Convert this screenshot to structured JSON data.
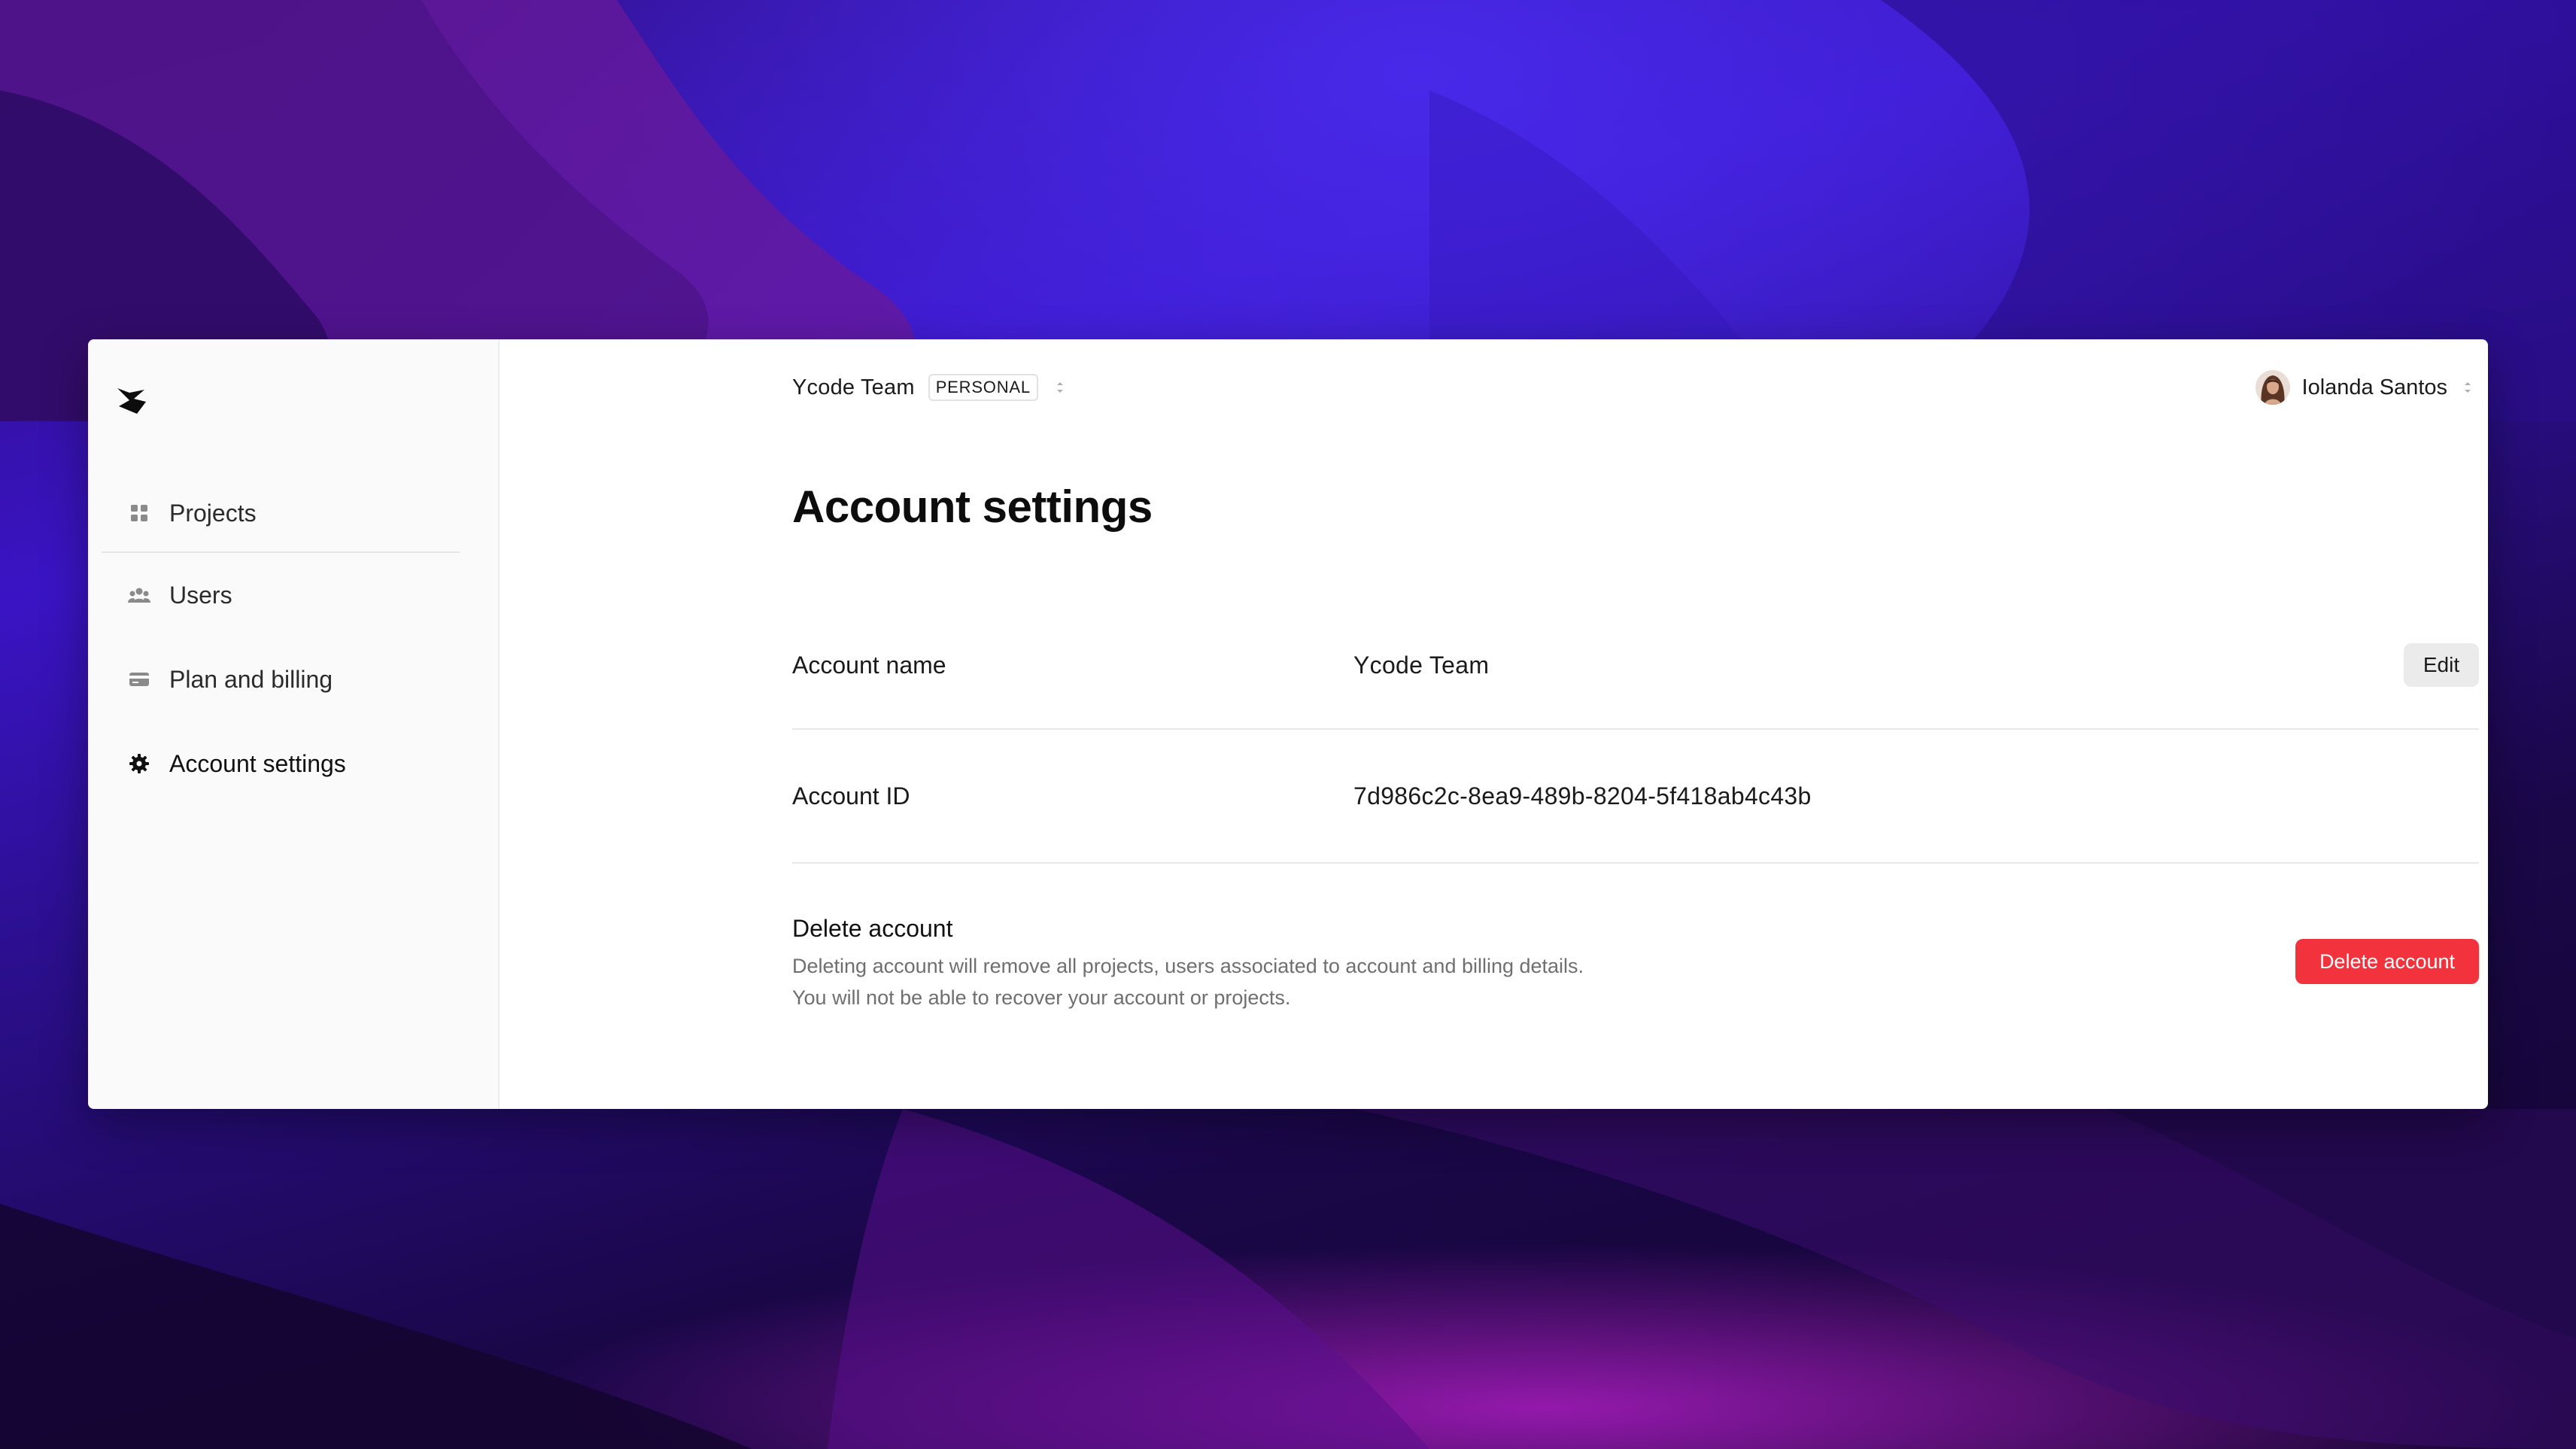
{
  "colors": {
    "accent_danger": "#f2333d",
    "sidebar_bg": "#fafafa",
    "window_bg": "#ffffff"
  },
  "header": {
    "team_name": "Ycode Team",
    "plan_badge": "PERSONAL",
    "user_name": "Iolanda Santos",
    "team_switcher_icon": "chevron-up-down-icon",
    "user_menu_icon": "chevron-up-down-icon"
  },
  "sidebar": {
    "logo_icon": "ycode-logo-icon",
    "items": [
      {
        "label": "Projects",
        "icon": "grid-icon"
      },
      {
        "label": "Users",
        "icon": "users-icon"
      },
      {
        "label": "Plan and billing",
        "icon": "credit-card-icon"
      },
      {
        "label": "Account settings",
        "icon": "gear-icon",
        "active": true
      }
    ]
  },
  "main": {
    "title": "Account settings",
    "account_name": {
      "label": "Account name",
      "value": "Ycode Team",
      "edit_label": "Edit"
    },
    "account_id": {
      "label": "Account ID",
      "value": "7d986c2c-8ea9-489b-8204-5f418ab4c43b"
    },
    "delete_account": {
      "title": "Delete account",
      "description": "Deleting account will remove all projects, users associated to account and billing details. You will not be able to recover your account or projects.",
      "button_label": "Delete account"
    }
  }
}
